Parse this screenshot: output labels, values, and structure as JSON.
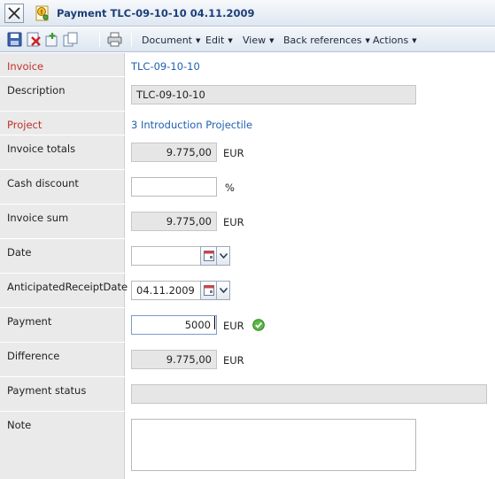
{
  "window": {
    "title": "Payment TLC-09-10-10 04.11.2009"
  },
  "toolbar": {
    "icons": [
      "save-icon",
      "delete-icon",
      "add-icon",
      "copy-icon",
      "print-icon"
    ],
    "menus": {
      "document": "Document",
      "edit": "Edit",
      "view": "View",
      "back_references": "Back references",
      "actions": "Actions"
    }
  },
  "form": {
    "invoice": {
      "label": "Invoice",
      "value": "TLC-09-10-10"
    },
    "description": {
      "label": "Description",
      "value": "TLC-09-10-10"
    },
    "project": {
      "label": "Project",
      "value": "3 Introduction Projectile"
    },
    "invoice_totals": {
      "label": "Invoice totals",
      "value": "9.775,00",
      "unit": "EUR"
    },
    "cash_discount": {
      "label": "Cash discount",
      "value": "",
      "unit": "%"
    },
    "invoice_sum": {
      "label": "Invoice sum",
      "value": "9.775,00",
      "unit": "EUR"
    },
    "date": {
      "label": "Date",
      "value": ""
    },
    "anticipated_receipt_date": {
      "label": "AnticipatedReceiptDate",
      "value": "04.11.2009"
    },
    "payment": {
      "label": "Payment",
      "value": "5000",
      "unit": "EUR",
      "status_icon": "check-icon"
    },
    "difference": {
      "label": "Difference",
      "value": "9.775,00",
      "unit": "EUR"
    },
    "payment_status": {
      "label": "Payment status",
      "value": ""
    },
    "note": {
      "label": "Note",
      "value": ""
    }
  },
  "colors": {
    "required_label": "#c0302a",
    "link": "#1f5fb2",
    "title_text": "#1c3f78",
    "label_column_bg": "#eaeaea",
    "readonly_field_bg": "#e6e6e6"
  }
}
